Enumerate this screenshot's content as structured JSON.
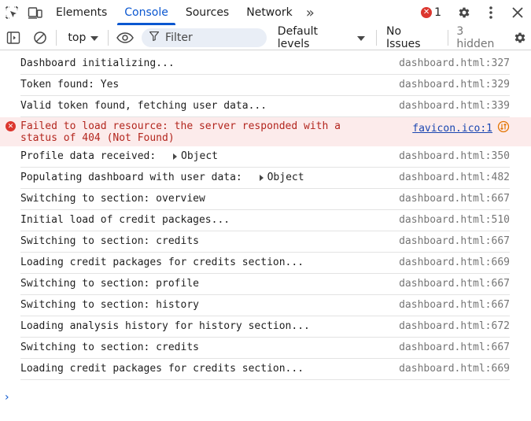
{
  "tabs": [
    {
      "label": "Elements",
      "active": false
    },
    {
      "label": "Console",
      "active": true
    },
    {
      "label": "Sources",
      "active": false
    },
    {
      "label": "Network",
      "active": false
    }
  ],
  "tabbar": {
    "more_label": "»",
    "error_count": "1"
  },
  "toolbar": {
    "context": "top",
    "filter_placeholder": "Filter",
    "levels": "Default levels",
    "issues": "No Issues",
    "hidden": "3 hidden"
  },
  "messages": [
    {
      "text": "Dashboard initializing...",
      "source": "dashboard.html:327"
    },
    {
      "text": "Token found: Yes",
      "source": "dashboard.html:329"
    },
    {
      "text": "Valid token found, fetching user data...",
      "source": "dashboard.html:339"
    },
    {
      "text": "Failed to load resource: the server responded with a status of 404 (Not Found)",
      "source": "favicon.ico:1",
      "level": "error"
    },
    {
      "text": "Profile data received: ",
      "object": "Object",
      "source": "dashboard.html:350"
    },
    {
      "text": "Populating dashboard with user data: ",
      "object": "Object",
      "source": "dashboard.html:482"
    },
    {
      "text": "Switching to section: overview",
      "source": "dashboard.html:667"
    },
    {
      "text": "Initial load of credit packages...",
      "source": "dashboard.html:510"
    },
    {
      "text": "Switching to section: credits",
      "source": "dashboard.html:667"
    },
    {
      "text": "Loading credit packages for credits section...",
      "source": "dashboard.html:669"
    },
    {
      "text": "Switching to section: profile",
      "source": "dashboard.html:667"
    },
    {
      "text": "Switching to section: history",
      "source": "dashboard.html:667"
    },
    {
      "text": "Loading analysis history for history section...",
      "source": "dashboard.html:672"
    },
    {
      "text": "Switching to section: credits",
      "source": "dashboard.html:667"
    },
    {
      "text": "Loading credit packages for credits section...",
      "source": "dashboard.html:669"
    }
  ],
  "prompt": "›",
  "colors": {
    "accent": "#0b57d0",
    "error": "#dc362e",
    "error_bg": "#fcebeb"
  },
  "icons": [
    "inspect-icon",
    "device-toggle-icon",
    "error-icon",
    "gear-icon",
    "kebab-menu-icon",
    "close-icon",
    "sidebar-icon",
    "clear-icon",
    "eye-icon",
    "filter-icon",
    "chevron-down-icon",
    "network-request-icon"
  ]
}
